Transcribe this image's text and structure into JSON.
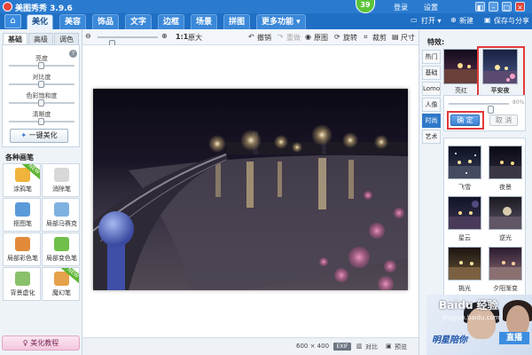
{
  "titlebar": {
    "app_title": "美图秀秀 3.9.6",
    "badge": "39",
    "login": "登录",
    "settings": "设置"
  },
  "menubar": {
    "tabs": [
      "美化",
      "美容",
      "饰品",
      "文字",
      "边框",
      "场景",
      "拼图",
      "更多功能 ▾"
    ],
    "active_tab": "美化",
    "open_label": "打开 ▾",
    "new_label": "新建",
    "save_label": "保存与分享"
  },
  "toolbar": {
    "zoom_label": "原大",
    "zoom_ratio": "1:1",
    "undo": "撤销",
    "redo": "重做",
    "original": "原图",
    "rotate": "旋转",
    "crop": "裁剪",
    "size": "尺寸"
  },
  "left_panel": {
    "tabs": [
      "基础",
      "高级",
      "调色"
    ],
    "active_tab": "基础",
    "sliders": [
      {
        "label": "亮度",
        "level": 0.5
      },
      {
        "label": "对比度",
        "level": 0.5
      },
      {
        "label": "色彩饱和度",
        "level": 0.5
      },
      {
        "label": "清晰度",
        "level": 0.5
      }
    ],
    "one_click_label": "一键美化",
    "brushes_heading": "各种画笔",
    "brushes": [
      {
        "label": "涂鸦笔",
        "color": "#f0b43c",
        "new": true
      },
      {
        "label": "消除笔",
        "color": "#d8d8d8",
        "new": false
      },
      {
        "label": "抠图笔",
        "color": "#5a9ad8",
        "new": false
      },
      {
        "label": "局部马赛克",
        "color": "#7fb2e0",
        "new": false
      },
      {
        "label": "局部彩色笔",
        "color": "#e28a3a",
        "new": false
      },
      {
        "label": "局部变色笔",
        "color": "#6fbf4a",
        "new": false
      },
      {
        "label": "背景虚化",
        "color": "#8ac06a",
        "new": false
      },
      {
        "label": "魔幻笔",
        "color": "#e6a24a",
        "new": true
      }
    ],
    "new_tag": "NEW",
    "tutorial_label": "美化教程"
  },
  "status": {
    "dimensions": "600 × 400",
    "exif": "EXIF",
    "compare": "对比",
    "preview": "预览"
  },
  "right_panel": {
    "title": "特效:",
    "categories": [
      "热门",
      "基础",
      "Lomo",
      "人像",
      "时尚",
      "艺术"
    ],
    "active_category": "时尚",
    "top_effects": [
      {
        "label": "亮红"
      },
      {
        "label": "平安夜"
      }
    ],
    "selected_effect": "平安夜",
    "strength_value": "80%",
    "confirm_label": "确 定",
    "cancel_label": "取 消",
    "effects": [
      {
        "label": "飞雪"
      },
      {
        "label": "夜景"
      },
      {
        "label": "星云"
      },
      {
        "label": "逆光"
      },
      {
        "label": "挑光"
      },
      {
        "label": "夕阳渐变"
      }
    ]
  },
  "ad": {
    "watermark": "Baidu 经验",
    "watermark_sub": "jingyan.baidu.com",
    "text": "明星陪你",
    "live": "直播"
  }
}
